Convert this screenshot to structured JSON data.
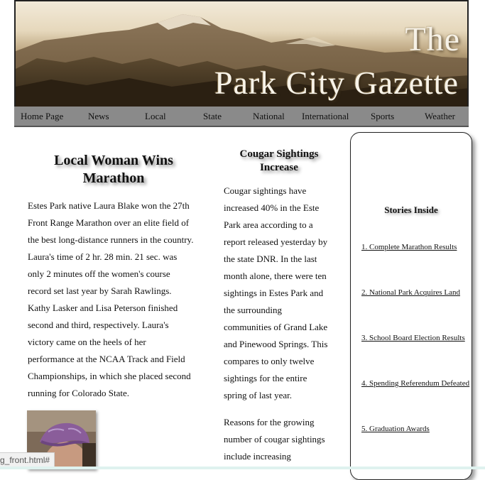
{
  "banner": {
    "title_the": "The",
    "title_main": "Park City Gazette"
  },
  "nav": {
    "items": [
      {
        "label": "Home Page"
      },
      {
        "label": "News"
      },
      {
        "label": "Local"
      },
      {
        "label": "State"
      },
      {
        "label": "National"
      },
      {
        "label": "International"
      },
      {
        "label": "Sports"
      },
      {
        "label": "Weather"
      }
    ]
  },
  "article1": {
    "headline_line1": "Local Woman Wins",
    "headline_line2": "Marathon",
    "body_lines": [
      "Estes Park native Laura Blake won the 27th",
      "Front Range Marathon over an elite field of",
      "the best long-distance runners in the country.",
      "Laura's time of 2 hr. 28 min. 21 sec. was",
      "only 2 minutes off the women's course",
      "record set last year by Sarah Rawlings.",
      "Kathy Lasker and Lisa Peterson finished",
      "second and third, respectively. Laura's",
      "victory came on the heels of her",
      "performance at the NCAA Track and Field",
      "Championships, in which she placed second",
      "running for Colorado State."
    ]
  },
  "article2": {
    "headline_line1": "Cougar Sightings",
    "headline_line2": "Increase",
    "para1_lines": [
      "Cougar sightings have",
      "increased 40% in the Este",
      "Park area according to a",
      "report released yesterday by",
      "the state DNR. In the last",
      "month alone, there were ten",
      "sightings in Estes Park and",
      "the surrounding",
      "communities of Grand Lake",
      "and Pinewood Springs. This",
      "compares to only twelve",
      "sightings for the entire",
      "spring of last year."
    ],
    "para2_lines": [
      "Reasons for the growing",
      "number of cougar sightings",
      "include increasing"
    ]
  },
  "sidebar": {
    "title": "Stories Inside",
    "stories": [
      "1. Complete Marathon Results",
      "2. National Park Acquires Land",
      "3. School Board Election Results",
      "4. Spending Referendum Defeated",
      "5. Graduation Awards"
    ]
  },
  "status_bar": {
    "url_text": "g_front.html#"
  }
}
